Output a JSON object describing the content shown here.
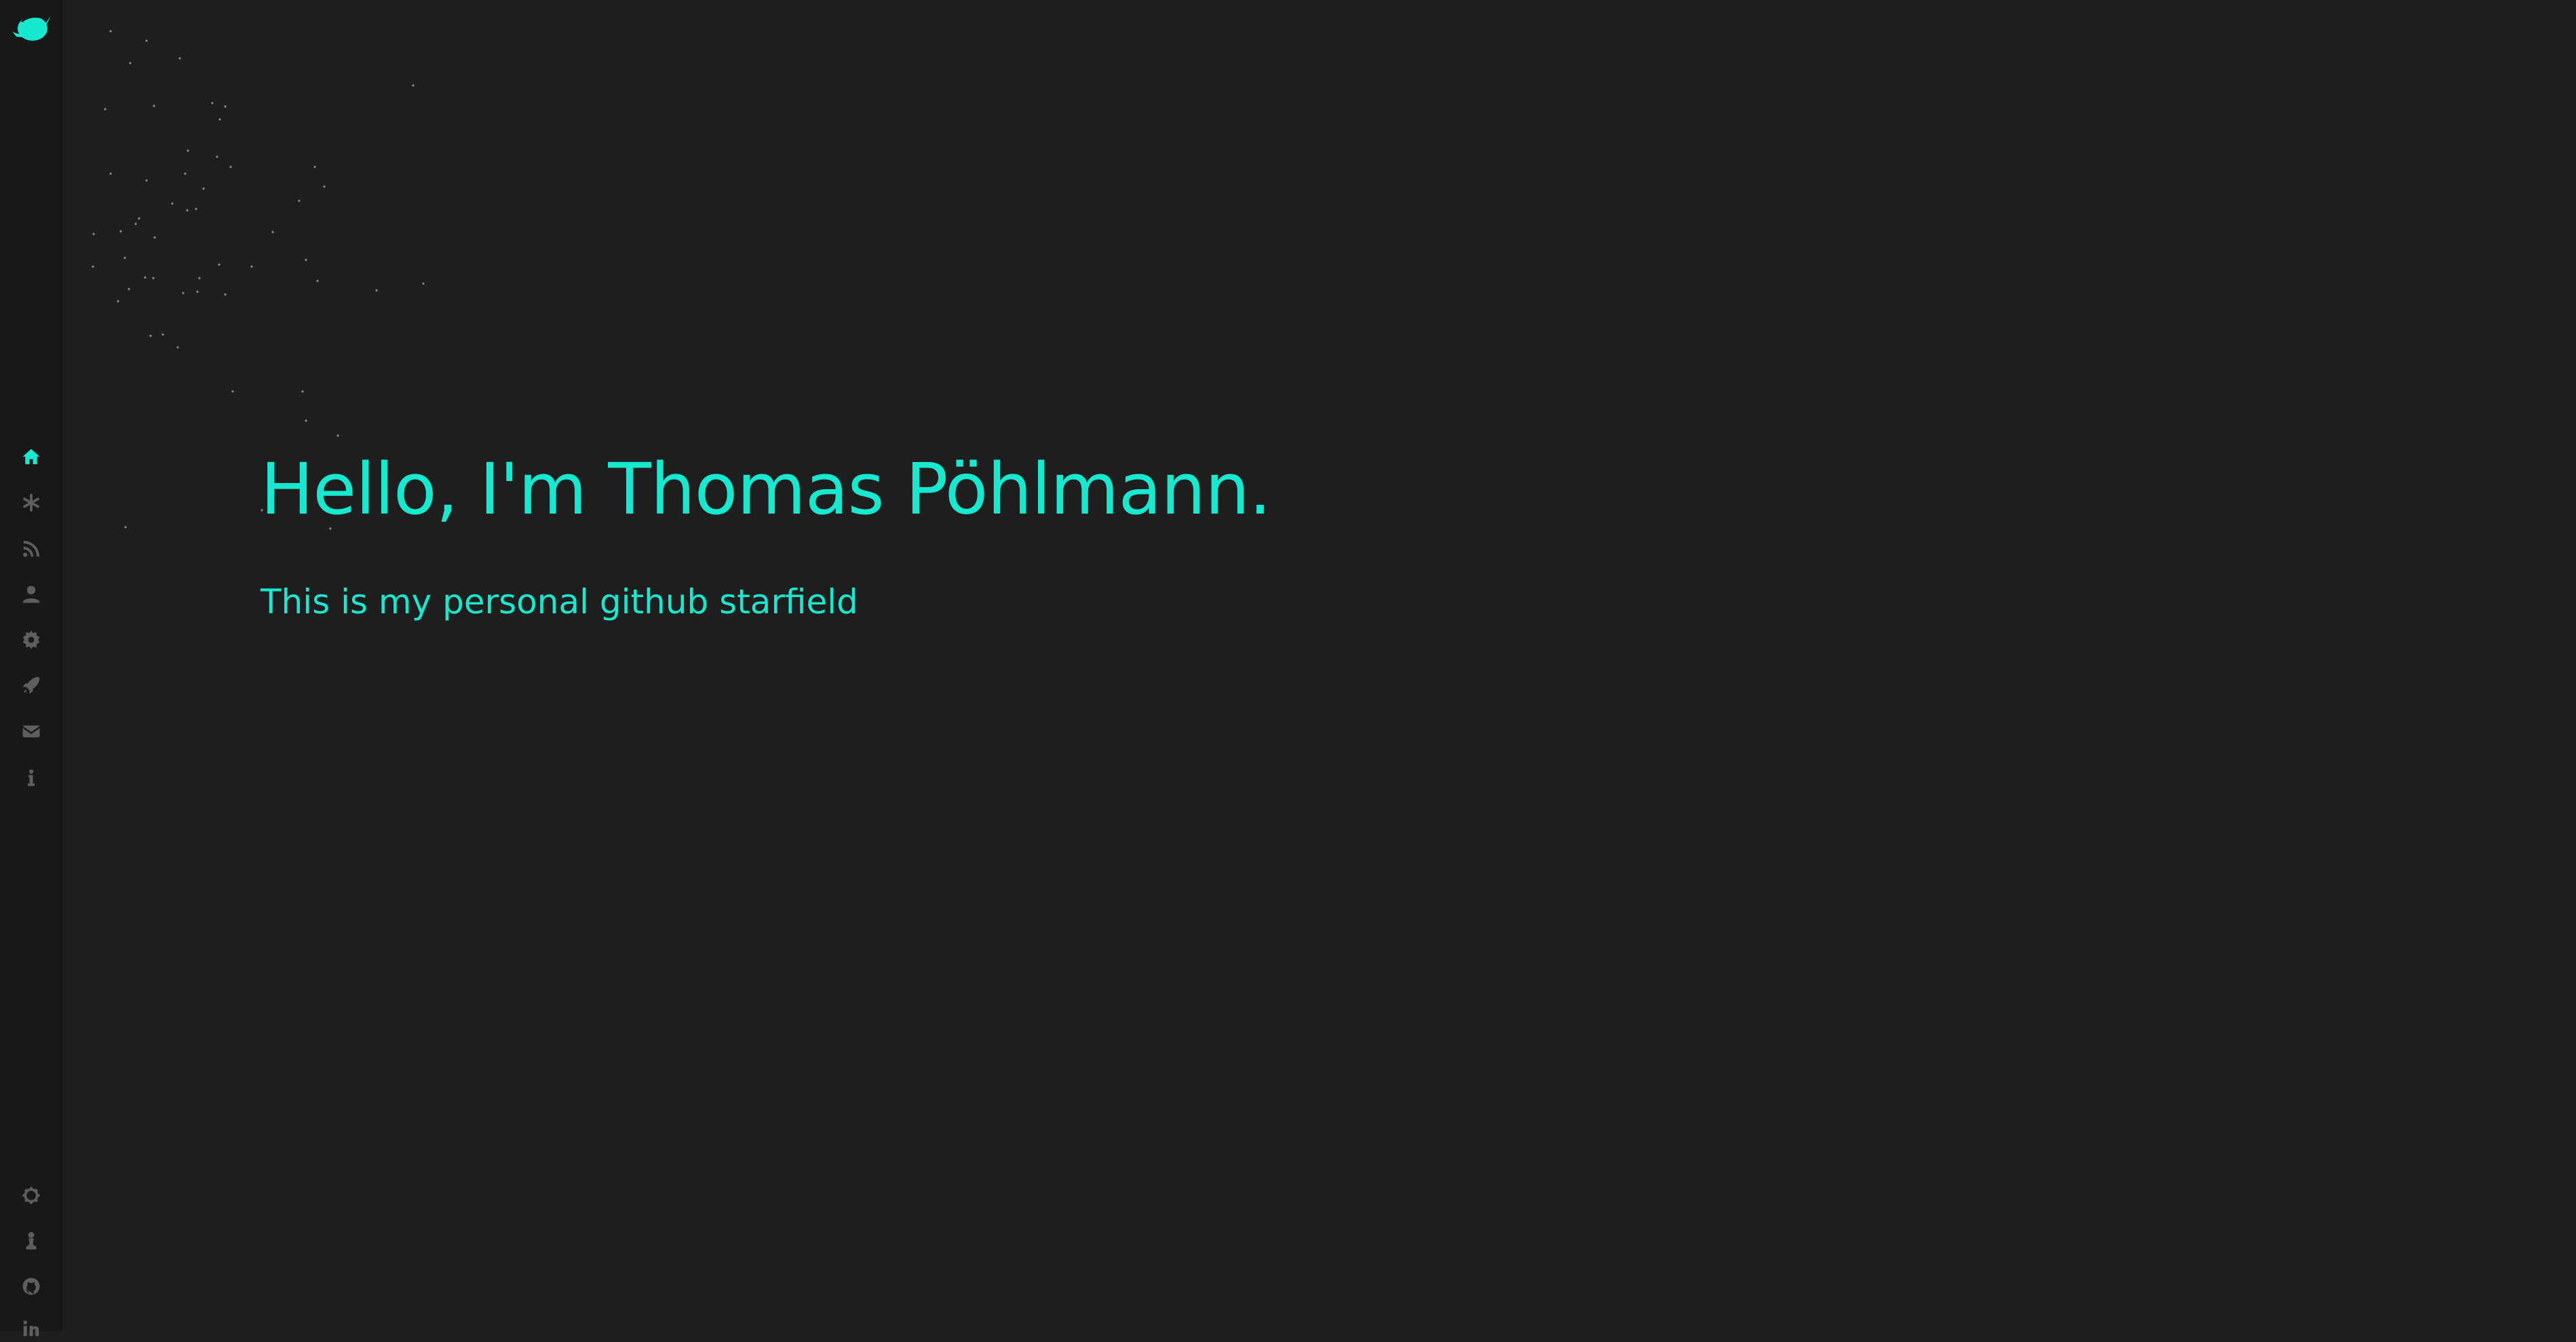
{
  "hero": {
    "title": "Hello, I'm Thomas Pöhlmann.",
    "subtitle": "This is my personal github starfield"
  },
  "sidebar": {
    "logo": "leaf-globe-logo",
    "items": [
      {
        "icon": "home-icon",
        "active": true
      },
      {
        "icon": "asterisk-icon",
        "active": false
      },
      {
        "icon": "rss-icon",
        "active": false
      },
      {
        "icon": "user-icon",
        "active": false
      },
      {
        "icon": "gear-icon",
        "active": false
      },
      {
        "icon": "rocket-icon",
        "active": false
      },
      {
        "icon": "envelope-icon",
        "active": false
      },
      {
        "icon": "info-icon",
        "active": false
      }
    ],
    "bottom_items": [
      {
        "icon": "settings-cog-icon"
      },
      {
        "icon": "chess-pawn-icon"
      },
      {
        "icon": "github-icon"
      },
      {
        "icon": "linkedin-icon"
      }
    ]
  },
  "colors": {
    "background": "#1e1e1f",
    "sidebar": "#181818",
    "accent": "#17e9d0",
    "icon_muted": "#5e5e5e",
    "star": "#8a8a8a"
  }
}
